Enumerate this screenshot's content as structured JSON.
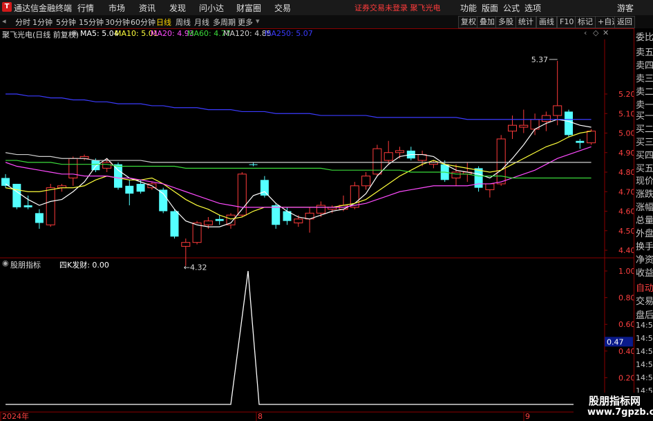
{
  "app": {
    "title": "通达信金融终端"
  },
  "menu": [
    "行情",
    "市场",
    "资讯",
    "发现",
    "问小达",
    "财富圈",
    "交易"
  ],
  "status_text": "证券交易未登录 聚飞光电",
  "top_right": [
    "功能",
    "版面",
    "公式",
    "选项",
    "游客"
  ],
  "periods": [
    "分时",
    "1分钟",
    "5分钟",
    "15分钟",
    "30分钟",
    "60分钟",
    "日线",
    "周线",
    "月线",
    "多周期",
    "更多"
  ],
  "active_period": "日线",
  "right_buttons": [
    "复权",
    "叠加",
    "多股",
    "统计",
    "画线",
    "F10",
    "标记",
    "+自选",
    "返回"
  ],
  "info": {
    "stock": "聚飞光电(日线 前复权)",
    "ma": [
      {
        "label": "MA5: 5.04",
        "color": "#ffffff"
      },
      {
        "label": "MA10: 5.01",
        "color": "#ffff3b"
      },
      {
        "label": "MA20: 4.93",
        "color": "#ff4bff"
      },
      {
        "label": "MA60: 4.77",
        "color": "#3bdc3b"
      },
      {
        "label": "MA120: 4.85",
        "color": "#cfcfcf"
      },
      {
        "label": "MA250: 5.07",
        "color": "#3b3bff"
      }
    ]
  },
  "right_panel": [
    "委比",
    "卖五",
    "卖四",
    "卖三",
    "卖二",
    "卖一",
    "买一",
    "买二",
    "买三",
    "买四",
    "买五",
    "现价",
    "涨跌",
    "涨幅",
    "总量",
    "外盘",
    "换手",
    "净资",
    "收益",
    "自动",
    "交易",
    "盘后",
    "14:56",
    "14:56",
    "14:56",
    "14:56",
    "14:56",
    "14:56",
    "14:56"
  ],
  "indicator": {
    "name": "股朋指标",
    "label": "四K发财: 0.00"
  },
  "chart_data": {
    "type": "candlestick",
    "y_ticks": [
      5.2,
      5.1,
      5.0,
      4.9,
      4.8,
      4.7,
      4.6,
      4.5,
      4.4
    ],
    "ylim": [
      4.35,
      5.3
    ],
    "annotations": [
      {
        "text": "5.37",
        "value": 5.37
      },
      {
        "text": "←4.32",
        "value": 4.32
      }
    ],
    "candles": [
      {
        "o": 4.77,
        "h": 4.79,
        "l": 4.72,
        "c": 4.73,
        "up": false
      },
      {
        "o": 4.74,
        "h": 4.74,
        "l": 4.61,
        "c": 4.62,
        "up": false
      },
      {
        "o": 4.63,
        "h": 4.68,
        "l": 4.61,
        "c": 4.62,
        "up": false
      },
      {
        "o": 4.59,
        "h": 4.61,
        "l": 4.51,
        "c": 4.54,
        "up": false
      },
      {
        "o": 4.53,
        "h": 4.74,
        "l": 4.52,
        "c": 4.72,
        "up": true
      },
      {
        "o": 4.72,
        "h": 4.74,
        "l": 4.7,
        "c": 4.73,
        "up": true
      },
      {
        "o": 4.77,
        "h": 4.88,
        "l": 4.73,
        "c": 4.87,
        "up": true
      },
      {
        "o": 4.87,
        "h": 4.89,
        "l": 4.86,
        "c": 4.88,
        "up": true
      },
      {
        "o": 4.86,
        "h": 4.87,
        "l": 4.8,
        "c": 4.81,
        "up": false
      },
      {
        "o": 4.82,
        "h": 4.87,
        "l": 4.8,
        "c": 4.85,
        "up": true
      },
      {
        "o": 4.84,
        "h": 4.85,
        "l": 4.71,
        "c": 4.72,
        "up": false
      },
      {
        "o": 4.73,
        "h": 4.76,
        "l": 4.63,
        "c": 4.69,
        "up": false
      },
      {
        "o": 4.74,
        "h": 4.76,
        "l": 4.69,
        "c": 4.7,
        "up": false
      },
      {
        "o": 4.72,
        "h": 4.75,
        "l": 4.71,
        "c": 4.74,
        "up": true
      },
      {
        "o": 4.71,
        "h": 4.72,
        "l": 4.59,
        "c": 4.6,
        "up": false
      },
      {
        "o": 4.6,
        "h": 4.61,
        "l": 4.46,
        "c": 4.47,
        "up": false
      },
      {
        "o": 4.42,
        "h": 4.46,
        "l": 4.32,
        "c": 4.44,
        "up": true
      },
      {
        "o": 4.44,
        "h": 4.55,
        "l": 4.43,
        "c": 4.54,
        "up": true
      },
      {
        "o": 4.53,
        "h": 4.57,
        "l": 4.51,
        "c": 4.55,
        "up": true
      },
      {
        "o": 4.56,
        "h": 4.58,
        "l": 4.53,
        "c": 4.55,
        "up": false
      },
      {
        "o": 4.53,
        "h": 4.59,
        "l": 4.51,
        "c": 4.58,
        "up": true
      },
      {
        "o": 4.58,
        "h": 4.8,
        "l": 4.57,
        "c": 4.79,
        "up": true
      },
      {
        "o": 4.84,
        "h": 4.85,
        "l": 4.83,
        "c": 4.84,
        "up": false
      },
      {
        "o": 4.76,
        "h": 4.78,
        "l": 4.67,
        "c": 4.68,
        "up": false
      },
      {
        "o": 4.63,
        "h": 4.64,
        "l": 4.51,
        "c": 4.53,
        "up": false
      },
      {
        "o": 4.6,
        "h": 4.62,
        "l": 4.53,
        "c": 4.55,
        "up": false
      },
      {
        "o": 4.54,
        "h": 4.58,
        "l": 4.52,
        "c": 4.56,
        "up": true
      },
      {
        "o": 4.56,
        "h": 4.62,
        "l": 4.49,
        "c": 4.59,
        "up": true
      },
      {
        "o": 4.59,
        "h": 4.65,
        "l": 4.57,
        "c": 4.63,
        "up": true
      },
      {
        "o": 4.61,
        "h": 4.63,
        "l": 4.59,
        "c": 4.62,
        "up": true
      },
      {
        "o": 4.61,
        "h": 4.68,
        "l": 4.6,
        "c": 4.63,
        "up": true
      },
      {
        "o": 4.62,
        "h": 4.75,
        "l": 4.61,
        "c": 4.73,
        "up": true
      },
      {
        "o": 4.73,
        "h": 4.8,
        "l": 4.71,
        "c": 4.78,
        "up": true
      },
      {
        "o": 4.79,
        "h": 4.94,
        "l": 4.78,
        "c": 4.92,
        "up": true
      },
      {
        "o": 4.86,
        "h": 4.96,
        "l": 4.84,
        "c": 4.9,
        "up": true
      },
      {
        "o": 4.9,
        "h": 4.93,
        "l": 4.87,
        "c": 4.91,
        "up": true
      },
      {
        "o": 4.91,
        "h": 4.93,
        "l": 4.86,
        "c": 4.87,
        "up": false
      },
      {
        "o": 4.89,
        "h": 4.91,
        "l": 4.83,
        "c": 4.86,
        "up": true
      },
      {
        "o": 4.84,
        "h": 4.86,
        "l": 4.82,
        "c": 4.85,
        "up": true
      },
      {
        "o": 4.84,
        "h": 4.86,
        "l": 4.75,
        "c": 4.76,
        "up": false
      },
      {
        "o": 4.77,
        "h": 4.84,
        "l": 4.73,
        "c": 4.8,
        "up": true
      },
      {
        "o": 4.8,
        "h": 4.85,
        "l": 4.75,
        "c": 4.79,
        "up": true
      },
      {
        "o": 4.82,
        "h": 4.83,
        "l": 4.7,
        "c": 4.72,
        "up": false
      },
      {
        "o": 4.71,
        "h": 4.74,
        "l": 4.67,
        "c": 4.74,
        "up": true
      },
      {
        "o": 4.74,
        "h": 4.99,
        "l": 4.73,
        "c": 4.97,
        "up": true
      },
      {
        "o": 5.01,
        "h": 5.09,
        "l": 4.97,
        "c": 5.04,
        "up": true
      },
      {
        "o": 5.04,
        "h": 5.12,
        "l": 5.0,
        "c": 5.03,
        "up": true
      },
      {
        "o": 5.02,
        "h": 5.1,
        "l": 4.99,
        "c": 5.07,
        "up": true
      },
      {
        "o": 5.06,
        "h": 5.11,
        "l": 5.01,
        "c": 5.09,
        "up": true
      },
      {
        "o": 5.09,
        "h": 5.37,
        "l": 5.04,
        "c": 5.14,
        "up": true
      },
      {
        "o": 5.11,
        "h": 5.12,
        "l": 4.98,
        "c": 4.99,
        "up": false
      },
      {
        "o": 4.96,
        "h": 4.97,
        "l": 4.92,
        "c": 4.95,
        "up": false
      },
      {
        "o": 4.95,
        "h": 5.02,
        "l": 4.94,
        "c": 5.01,
        "up": true
      }
    ],
    "ma": [
      {
        "name": "MA5",
        "color": "#ffffff",
        "values": [
          4.74,
          4.7,
          4.66,
          4.63,
          4.65,
          4.66,
          4.7,
          4.75,
          4.83,
          4.87,
          4.81,
          4.77,
          4.75,
          4.73,
          4.69,
          4.61,
          4.55,
          4.53,
          4.52,
          4.52,
          4.54,
          4.61,
          4.68,
          4.7,
          4.64,
          4.6,
          4.57,
          4.56,
          4.58,
          4.6,
          4.61,
          4.64,
          4.69,
          4.78,
          4.84,
          4.88,
          4.89,
          4.89,
          4.88,
          4.84,
          4.81,
          4.8,
          4.79,
          4.77,
          4.81,
          4.87,
          4.94,
          5.02,
          5.05,
          5.07,
          5.06,
          5.04,
          5.03
        ]
      },
      {
        "name": "MA10",
        "color": "#ffff3b",
        "values": [
          4.72,
          4.71,
          4.7,
          4.7,
          4.71,
          4.72,
          4.72,
          4.73,
          4.76,
          4.78,
          4.77,
          4.76,
          4.76,
          4.77,
          4.74,
          4.7,
          4.66,
          4.63,
          4.61,
          4.58,
          4.56,
          4.57,
          4.6,
          4.62,
          4.62,
          4.62,
          4.62,
          4.62,
          4.62,
          4.62,
          4.63,
          4.64,
          4.66,
          4.7,
          4.74,
          4.78,
          4.81,
          4.84,
          4.86,
          4.84,
          4.83,
          4.82,
          4.81,
          4.8,
          4.81,
          4.84,
          4.87,
          4.9,
          4.93,
          4.95,
          4.98,
          5.0,
          5.01
        ]
      },
      {
        "name": "MA20",
        "color": "#ff4bff",
        "values": [
          4.85,
          4.83,
          4.82,
          4.81,
          4.8,
          4.79,
          4.79,
          4.78,
          4.78,
          4.78,
          4.77,
          4.77,
          4.76,
          4.75,
          4.74,
          4.72,
          4.7,
          4.68,
          4.66,
          4.64,
          4.63,
          4.62,
          4.62,
          4.62,
          4.62,
          4.62,
          4.62,
          4.62,
          4.62,
          4.62,
          4.62,
          4.63,
          4.64,
          4.66,
          4.68,
          4.7,
          4.71,
          4.72,
          4.73,
          4.73,
          4.73,
          4.73,
          4.74,
          4.74,
          4.75,
          4.77,
          4.79,
          4.81,
          4.84,
          4.87,
          4.89,
          4.91,
          4.93
        ]
      },
      {
        "name": "MA60",
        "color": "#3bdc3b",
        "values": [
          4.86,
          4.86,
          4.85,
          4.85,
          4.85,
          4.84,
          4.84,
          4.84,
          4.84,
          4.84,
          4.83,
          4.83,
          4.83,
          4.83,
          4.83,
          4.83,
          4.82,
          4.82,
          4.82,
          4.82,
          4.82,
          4.82,
          4.82,
          4.82,
          4.82,
          4.82,
          4.82,
          4.82,
          4.82,
          4.81,
          4.81,
          4.81,
          4.81,
          4.81,
          4.81,
          4.81,
          4.8,
          4.8,
          4.8,
          4.8,
          4.79,
          4.79,
          4.78,
          4.78,
          4.78,
          4.77,
          4.77,
          4.77,
          4.77,
          4.77,
          4.77,
          4.77,
          4.77
        ]
      },
      {
        "name": "MA120",
        "color": "#cfcfcf",
        "values": [
          4.9,
          4.89,
          4.89,
          4.88,
          4.88,
          4.87,
          4.87,
          4.87,
          4.86,
          4.86,
          4.86,
          4.86,
          4.86,
          4.85,
          4.85,
          4.85,
          4.85,
          4.85,
          4.85,
          4.85,
          4.85,
          4.85,
          4.85,
          4.85,
          4.85,
          4.85,
          4.85,
          4.85,
          4.85,
          4.85,
          4.85,
          4.85,
          4.85,
          4.85,
          4.85,
          4.85,
          4.85,
          4.85,
          4.85,
          4.85,
          4.85,
          4.85,
          4.85,
          4.85,
          4.85,
          4.85,
          4.85,
          4.85,
          4.85,
          4.85,
          4.85,
          4.85,
          4.85
        ]
      },
      {
        "name": "MA250",
        "color": "#3b3bff",
        "values": [
          5.2,
          5.2,
          5.19,
          5.19,
          5.18,
          5.18,
          5.17,
          5.17,
          5.16,
          5.16,
          5.15,
          5.15,
          5.15,
          5.14,
          5.14,
          5.13,
          5.13,
          5.13,
          5.12,
          5.12,
          5.12,
          5.11,
          5.11,
          5.11,
          5.1,
          5.1,
          5.1,
          5.1,
          5.09,
          5.09,
          5.09,
          5.09,
          5.09,
          5.08,
          5.08,
          5.08,
          5.08,
          5.08,
          5.08,
          5.08,
          5.08,
          5.07,
          5.07,
          5.07,
          5.07,
          5.07,
          5.07,
          5.07,
          5.07,
          5.07,
          5.07,
          5.07,
          5.07
        ]
      }
    ],
    "indicator_ticks": [
      "1.00",
      "0.80",
      "0.60",
      "0.40",
      "0.20"
    ],
    "indicator_current": "0.47",
    "indicator_values": [
      0,
      0,
      0,
      0,
      0,
      0,
      0,
      0,
      0,
      0,
      0,
      0,
      0,
      0,
      0,
      0,
      0,
      0,
      0,
      0,
      0,
      1,
      0,
      0,
      0,
      0,
      0,
      0,
      0,
      0,
      0,
      0,
      0,
      0,
      0,
      0,
      0,
      0,
      0,
      0,
      0,
      0,
      0,
      0,
      0,
      0,
      0,
      0,
      0,
      0,
      0,
      0,
      0
    ],
    "x_labels": [
      {
        "text": "2024年",
        "index": 0
      },
      {
        "text": "8",
        "index": 22
      },
      {
        "text": "9",
        "index": 46
      }
    ]
  },
  "watermark": {
    "line1": "股朋指标网",
    "line2": "www.7gpzb.com"
  }
}
